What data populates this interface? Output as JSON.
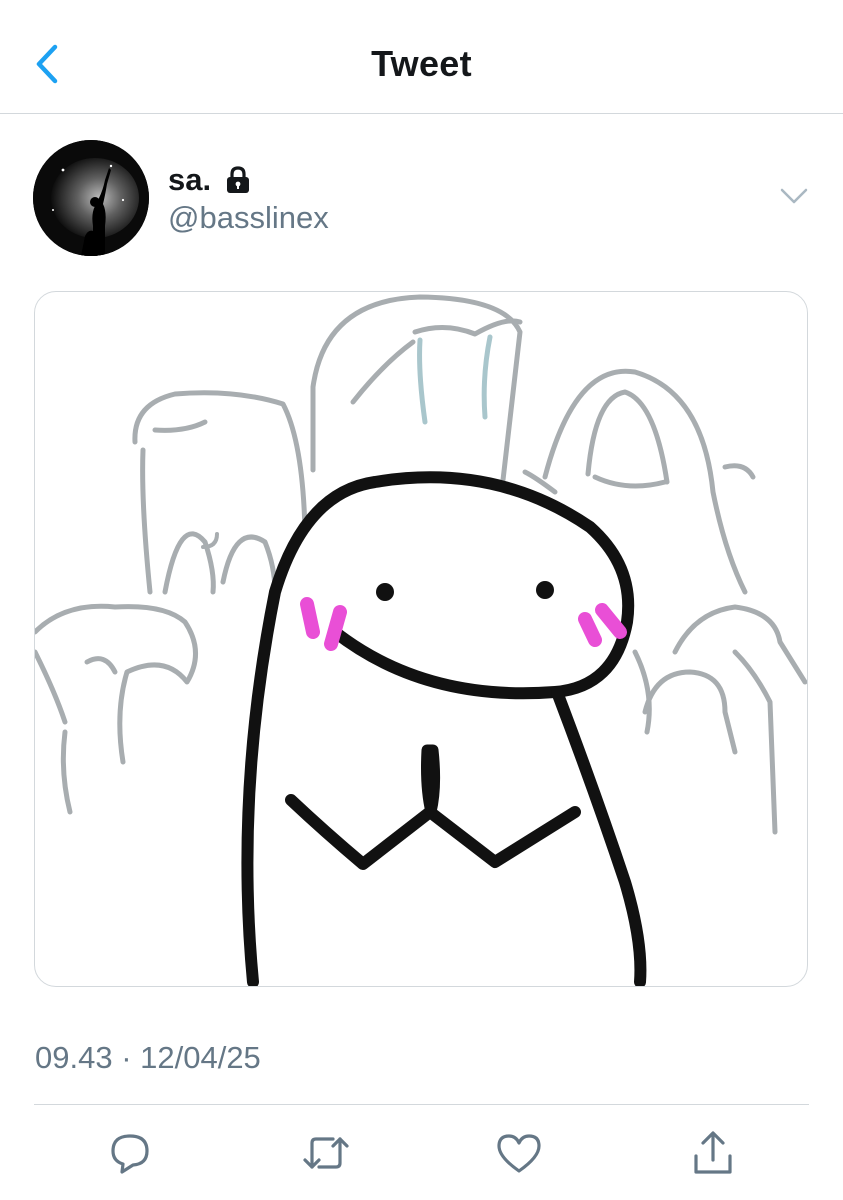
{
  "header": {
    "title": "Tweet",
    "back_icon": "chevron-left-icon"
  },
  "author": {
    "display_name": "sa.",
    "handle": "@basslinex",
    "protected_icon": "lock-icon"
  },
  "tweet": {
    "timestamp": "09.43 · 12/04/25"
  },
  "actions": {
    "reply_icon": "reply-icon",
    "retweet_icon": "retweet-icon",
    "like_icon": "heart-icon",
    "share_icon": "share-icon"
  },
  "colors": {
    "accent": "#1da1f2",
    "secondary_text": "#657786",
    "border": "#d3d8dc",
    "blush": "#e94fd6"
  }
}
